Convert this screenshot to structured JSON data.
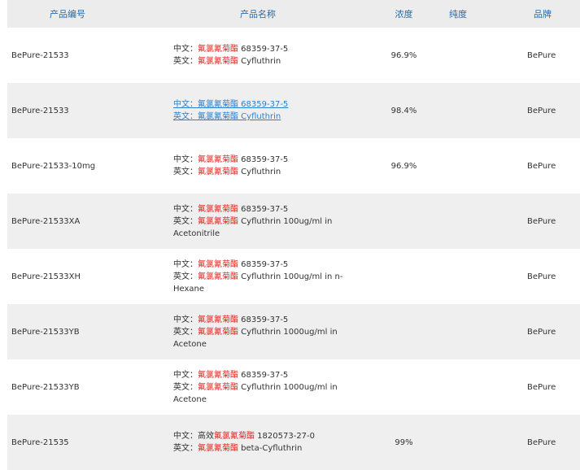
{
  "table": {
    "headers": [
      "产品编号",
      "产品名称",
      "浓度",
      "纯度",
      "品牌"
    ],
    "labels": {
      "cn": "中文：",
      "en": "英文："
    },
    "rows": [
      {
        "code": "BePure-21533",
        "cn_prefix": "",
        "cn_keyword": "氟氯氰菊酯",
        "cn_rest": " 68359-37-5",
        "en_keyword": "氟氯氰菊酯",
        "en_rest": " Cyfluthrin",
        "concentration": "96.9%",
        "purity": "",
        "brand": "BePure",
        "is_link": false
      },
      {
        "code": "BePure-21533",
        "cn_prefix": "",
        "cn_keyword": "氟氯氰菊酯",
        "cn_rest": " 68359-37-5",
        "en_keyword": "氟氯氰菊酯",
        "en_rest": " Cyfluthrin",
        "concentration": "98.4%",
        "purity": "",
        "brand": "BePure",
        "is_link": true
      },
      {
        "code": "BePure-21533-10mg",
        "cn_prefix": "",
        "cn_keyword": "氟氯氰菊酯",
        "cn_rest": " 68359-37-5",
        "en_keyword": "氟氯氰菊酯",
        "en_rest": " Cyfluthrin",
        "concentration": "96.9%",
        "purity": "",
        "brand": "BePure",
        "is_link": false
      },
      {
        "code": "BePure-21533XA",
        "cn_prefix": "",
        "cn_keyword": "氟氯氰菊酯",
        "cn_rest": " 68359-37-5",
        "en_keyword": "氟氯氰菊酯",
        "en_rest": " Cyfluthrin 100ug/ml in Acetonitrile",
        "concentration": "",
        "purity": "",
        "brand": "BePure",
        "is_link": false
      },
      {
        "code": "BePure-21533XH",
        "cn_prefix": "",
        "cn_keyword": "氟氯氰菊酯",
        "cn_rest": " 68359-37-5",
        "en_keyword": "氟氯氰菊酯",
        "en_rest": " Cyfluthrin 100ug/ml in n-Hexane",
        "concentration": "",
        "purity": "",
        "brand": "BePure",
        "is_link": false
      },
      {
        "code": "BePure-21533YB",
        "cn_prefix": "",
        "cn_keyword": "氟氯氰菊酯",
        "cn_rest": " 68359-37-5",
        "en_keyword": "氟氯氰菊酯",
        "en_rest": " Cyfluthrin 1000ug/ml in Acetone",
        "concentration": "",
        "purity": "",
        "brand": "BePure",
        "is_link": false
      },
      {
        "code": "BePure-21533YB",
        "cn_prefix": "",
        "cn_keyword": "氟氯氰菊酯",
        "cn_rest": " 68359-37-5",
        "en_keyword": "氟氯氰菊酯",
        "en_rest": " Cyfluthrin 1000ug/ml in Acetone",
        "concentration": "",
        "purity": "",
        "brand": "BePure",
        "is_link": false
      },
      {
        "code": "BePure-21535",
        "cn_prefix": "高效",
        "cn_keyword": "氟氯氰菊酯",
        "cn_rest": " 1820573-27-0",
        "en_keyword": "氟氯氰菊酯",
        "en_rest": " beta-Cyfluthrin",
        "concentration": "99%",
        "purity": "",
        "brand": "BePure",
        "is_link": false
      }
    ]
  }
}
